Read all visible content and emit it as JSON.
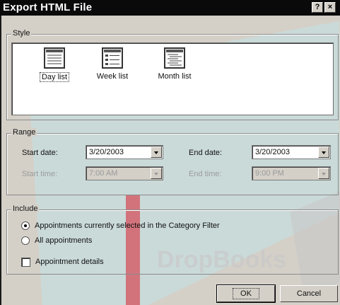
{
  "window": {
    "title": "Export HTML File",
    "help_glyph": "?",
    "close_glyph": "×"
  },
  "style_group": {
    "label": "Style",
    "options": [
      {
        "label": "Day list",
        "icon": "day-list-icon",
        "selected": true
      },
      {
        "label": "Week list",
        "icon": "week-list-icon",
        "selected": false
      },
      {
        "label": "Month list",
        "icon": "month-list-icon",
        "selected": false
      }
    ]
  },
  "range_group": {
    "label": "Range",
    "start_date_label": "Start date:",
    "start_date_value": "3/20/2003",
    "end_date_label": "End date:",
    "end_date_value": "3/20/2003",
    "start_time_label": "Start time:",
    "start_time_value": "7:00 AM",
    "end_time_label": "End time:",
    "end_time_value": "9:00 PM"
  },
  "include_group": {
    "label": "Include",
    "radio_selected_label": "Appointments currently selected in the Category Filter",
    "radio_all_label": "All appointments",
    "checkbox_label": "Appointment details"
  },
  "buttons": {
    "ok": "OK",
    "cancel": "Cancel"
  },
  "watermark": "DropBooks",
  "colors": {
    "titlebar": "#0a0a0a",
    "dialog_face": "#d4d0c8",
    "watermark_cyan": "#bfe6ee",
    "watermark_red": "#d63c4a"
  }
}
